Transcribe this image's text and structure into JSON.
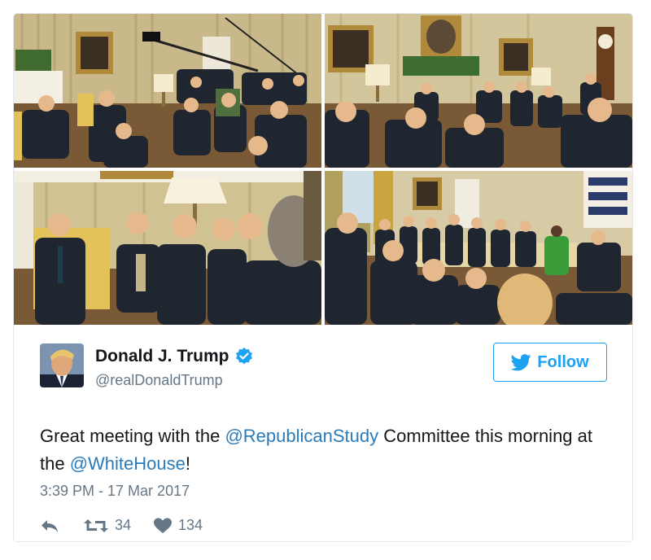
{
  "tweet": {
    "author": {
      "name": "Donald J. Trump",
      "handle": "@realDonaldTrump",
      "verified": true,
      "avatar_icon": "profile-photo"
    },
    "follow_label": "Follow",
    "text": {
      "part1": "Great meeting with the ",
      "mention1": "@RepublicanStudy",
      "part2": " Committee this morning at the ",
      "mention2": "@WhiteHouse",
      "part3": "!"
    },
    "timestamp": "3:39 PM - 17 Mar 2017",
    "stats": {
      "retweets": "34",
      "likes": "134"
    },
    "media": [
      {
        "icon": "oval-office-meeting-photo-1"
      },
      {
        "icon": "oval-office-meeting-photo-2"
      },
      {
        "icon": "oval-office-meeting-photo-3"
      },
      {
        "icon": "oval-office-meeting-photo-4"
      }
    ]
  },
  "colors": {
    "accent": "#1da1f2",
    "link": "#2b7bb9",
    "muted": "#657786",
    "text": "#14171a",
    "border": "#e1e8ed"
  }
}
